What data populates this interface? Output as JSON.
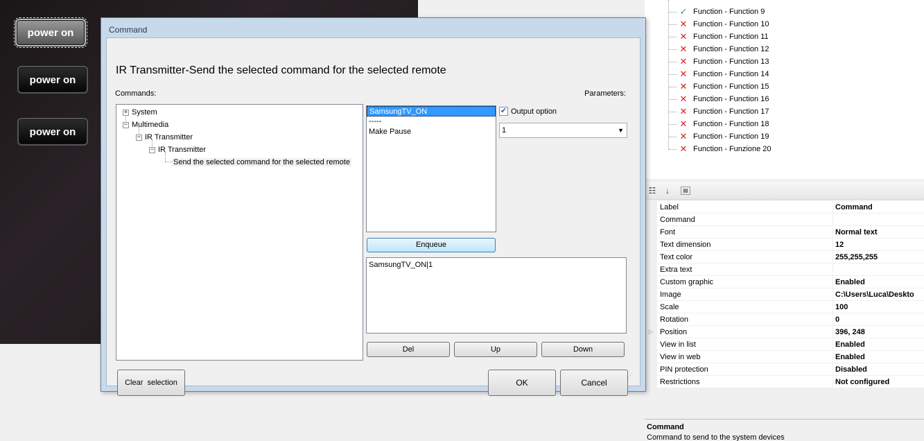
{
  "canvas": {
    "buttons": [
      "power on",
      "power on",
      "power on"
    ]
  },
  "function_tree": {
    "items": [
      {
        "label": "Function - Function 9",
        "status": "ok"
      },
      {
        "label": "Function - Function 10",
        "status": "error"
      },
      {
        "label": "Function - Function 11",
        "status": "error"
      },
      {
        "label": "Function - Function 12",
        "status": "error"
      },
      {
        "label": "Function - Function 13",
        "status": "error"
      },
      {
        "label": "Function - Function 14",
        "status": "error"
      },
      {
        "label": "Function - Function 15",
        "status": "error"
      },
      {
        "label": "Function - Function 16",
        "status": "error"
      },
      {
        "label": "Function - Function 17",
        "status": "error"
      },
      {
        "label": "Function - Function 18",
        "status": "error"
      },
      {
        "label": "Function - Function 19",
        "status": "error"
      },
      {
        "label": "Function - Funzione 20",
        "status": "error"
      }
    ]
  },
  "property_grid": {
    "rows": [
      {
        "name": "Label",
        "value": "Command"
      },
      {
        "name": "Command",
        "value": ""
      },
      {
        "name": "Font",
        "value": "Normal text"
      },
      {
        "name": "Text dimension",
        "value": "12"
      },
      {
        "name": "Text color",
        "value": "255,255,255"
      },
      {
        "name": "Extra text",
        "value": ""
      },
      {
        "name": "Custom graphic",
        "value": "Enabled"
      },
      {
        "name": "Image",
        "value": "C:\\Users\\Luca\\Deskto"
      },
      {
        "name": "Scale",
        "value": "100"
      },
      {
        "name": "Rotation",
        "value": "0"
      },
      {
        "name": "Position",
        "value": "396, 248"
      },
      {
        "name": "View in list",
        "value": "Enabled"
      },
      {
        "name": "View in web",
        "value": "Enabled"
      },
      {
        "name": "PIN protection",
        "value": "Disabled"
      },
      {
        "name": "Restrictions",
        "value": "Not configured"
      }
    ],
    "description_title": "Command",
    "description_text": "Command to send to the system devices"
  },
  "dialog": {
    "title": "Command",
    "heading": "IR Transmitter-Send the selected command for the selected remote",
    "commands_label": "Commands:",
    "parameters_label": "Parameters:",
    "tree": {
      "system": "System",
      "multimedia": "Multimedia",
      "ir1": "IR Transmitter",
      "ir2": "IR Transmitter",
      "leaf": "Send the selected command for the selected remote"
    },
    "command_list": [
      "SamsungTV_ON",
      "-----",
      "Make Pause"
    ],
    "output_option_label": "Output option",
    "output_value": "1",
    "enqueue": "Enqueue",
    "queue_text": "SamsungTV_ON|1",
    "del": "Del",
    "up": "Up",
    "down": "Down",
    "clear_selection": "Clear  selection",
    "ok": "OK",
    "cancel": "Cancel"
  }
}
